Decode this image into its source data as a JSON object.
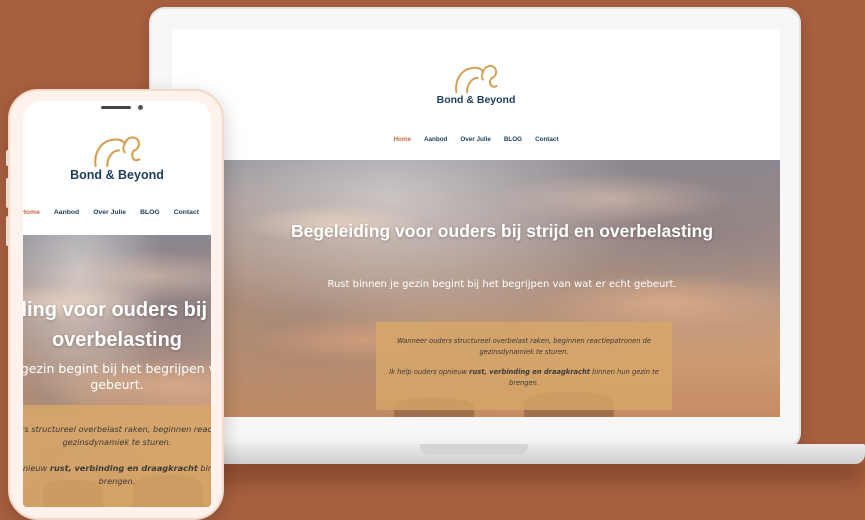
{
  "site": {
    "logo_text": "Bond & Beyond",
    "logo_icon": "elephant-line-icon",
    "nav": [
      "Home",
      "Aanbod",
      "Over Julie",
      "BLOG",
      "Contact"
    ],
    "hero": {
      "title": "Begeleiding voor ouders bij strijd en overbelasting",
      "subtitle": "Rust binnen je gezin begint bij het begrijpen van wat er echt gebeurt.",
      "quote_line1": "Wanneer ouders structureel overbelast raken, beginnen reactiepatronen de gezinsdynamiek te sturen.",
      "quote_line2_prefix": "Ik help ouders opnieuw ",
      "quote_line2_bold": "rust, verbinding en draagkracht",
      "quote_line2_suffix": " binnen hun gezin te brengen."
    }
  },
  "colors": {
    "background": "#a9603f",
    "brand_navy": "#1f3d5c",
    "brand_gold": "#d4a054",
    "nav_active": "#c46b45"
  }
}
